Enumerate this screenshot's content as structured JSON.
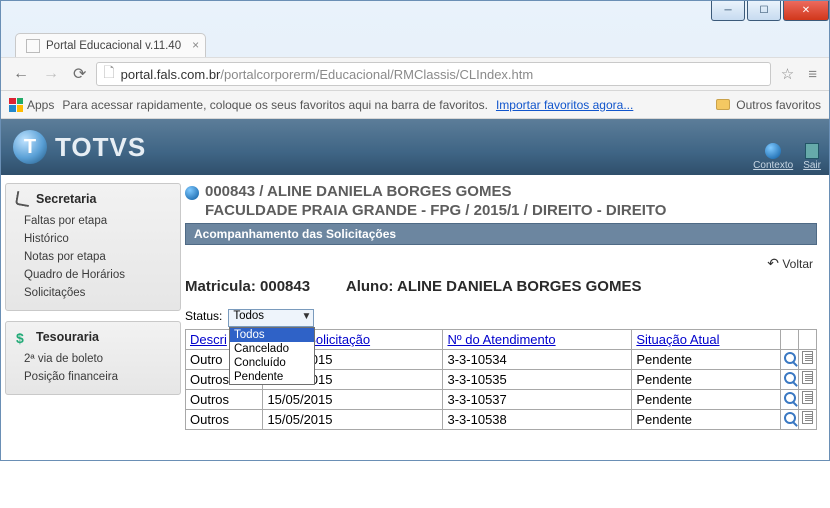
{
  "window": {
    "tab_title": "Portal Educacional v.11.40",
    "url_host": "portal.fals.com.br",
    "url_path": "/portalcorporerm/Educacional/RMClassis/CLIndex.htm"
  },
  "bookmarks": {
    "apps_label": "Apps",
    "hint_prefix": "Para acessar rapidamente, coloque os seus favoritos aqui na barra de favoritos.",
    "import_link": "Importar favoritos agora...",
    "other": "Outros favoritos"
  },
  "brand": {
    "word": "TOTVS"
  },
  "header_links": {
    "contexto": "Contexto",
    "sair": "Sair"
  },
  "sidebar": {
    "sections": [
      {
        "title": "Secretaria",
        "items": [
          "Faltas por etapa",
          "Histórico",
          "Notas por etapa",
          "Quadro de Horários",
          "Solicitações"
        ]
      },
      {
        "title": "Tesouraria",
        "items": [
          "2ª via de boleto",
          "Posição financeira"
        ]
      }
    ]
  },
  "student": {
    "line1": "000843 / ALINE DANIELA BORGES GOMES",
    "line2": "FACULDADE PRAIA GRANDE - FPG / 2015/1 / DIREITO - DIREITO"
  },
  "section_title": "Acompanhamento das Solicitações",
  "voltar_label": "Voltar",
  "info": {
    "matricula_label": "Matricula:",
    "matricula_value": "000843",
    "aluno_label": "Aluno:",
    "aluno_value": "ALINE DANIELA BORGES GOMES"
  },
  "status": {
    "label": "Status:",
    "selected": "Todos",
    "options": [
      "Todos",
      "Cancelado",
      "Concluído",
      "Pendente"
    ]
  },
  "table": {
    "headers": [
      "Descri",
      "ata da Solicitação",
      "Nº do Atendimento",
      "Situação Atual"
    ],
    "header_full": [
      "Descrição",
      "Data da Solicitação",
      "Nº do Atendimento",
      "Situação Atual"
    ],
    "rows": [
      {
        "desc": "Outro",
        "data": "15/05/2015",
        "atend": "3-3-10534",
        "sit": "Pendente"
      },
      {
        "desc": "Outros",
        "data": "15/05/2015",
        "atend": "3-3-10535",
        "sit": "Pendente"
      },
      {
        "desc": "Outros",
        "data": "15/05/2015",
        "atend": "3-3-10537",
        "sit": "Pendente"
      },
      {
        "desc": "Outros",
        "data": "15/05/2015",
        "atend": "3-3-10538",
        "sit": "Pendente"
      }
    ]
  }
}
